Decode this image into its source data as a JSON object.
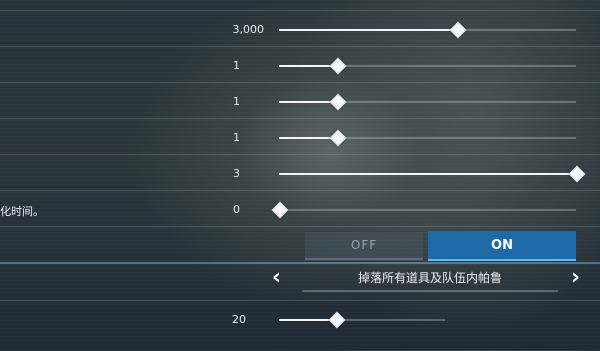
{
  "settings": {
    "row1": {
      "value": "3,000",
      "fraction": 0.6
    },
    "row2": {
      "value": "1",
      "fraction": 0.2
    },
    "row3": {
      "value": "1",
      "fraction": 0.2
    },
    "row4": {
      "value": "1",
      "fraction": 0.2
    },
    "row5": {
      "value": "3",
      "fraction": 1.0
    },
    "row6": {
      "label": "化时间。",
      "value": "0",
      "fraction": 0.0
    },
    "toggle": {
      "off_label": "OFF",
      "on_label": "ON",
      "selected": "ON"
    },
    "selector": {
      "value": "掉落所有道具及队伍内帕鲁",
      "prev_icon": "chevron-left-icon",
      "next_icon": "chevron-right-icon"
    },
    "row9": {
      "value": "20",
      "fraction": 0.35
    }
  },
  "colors": {
    "accent": "#1e6aa8",
    "accent_line": "#6fb4e6"
  }
}
